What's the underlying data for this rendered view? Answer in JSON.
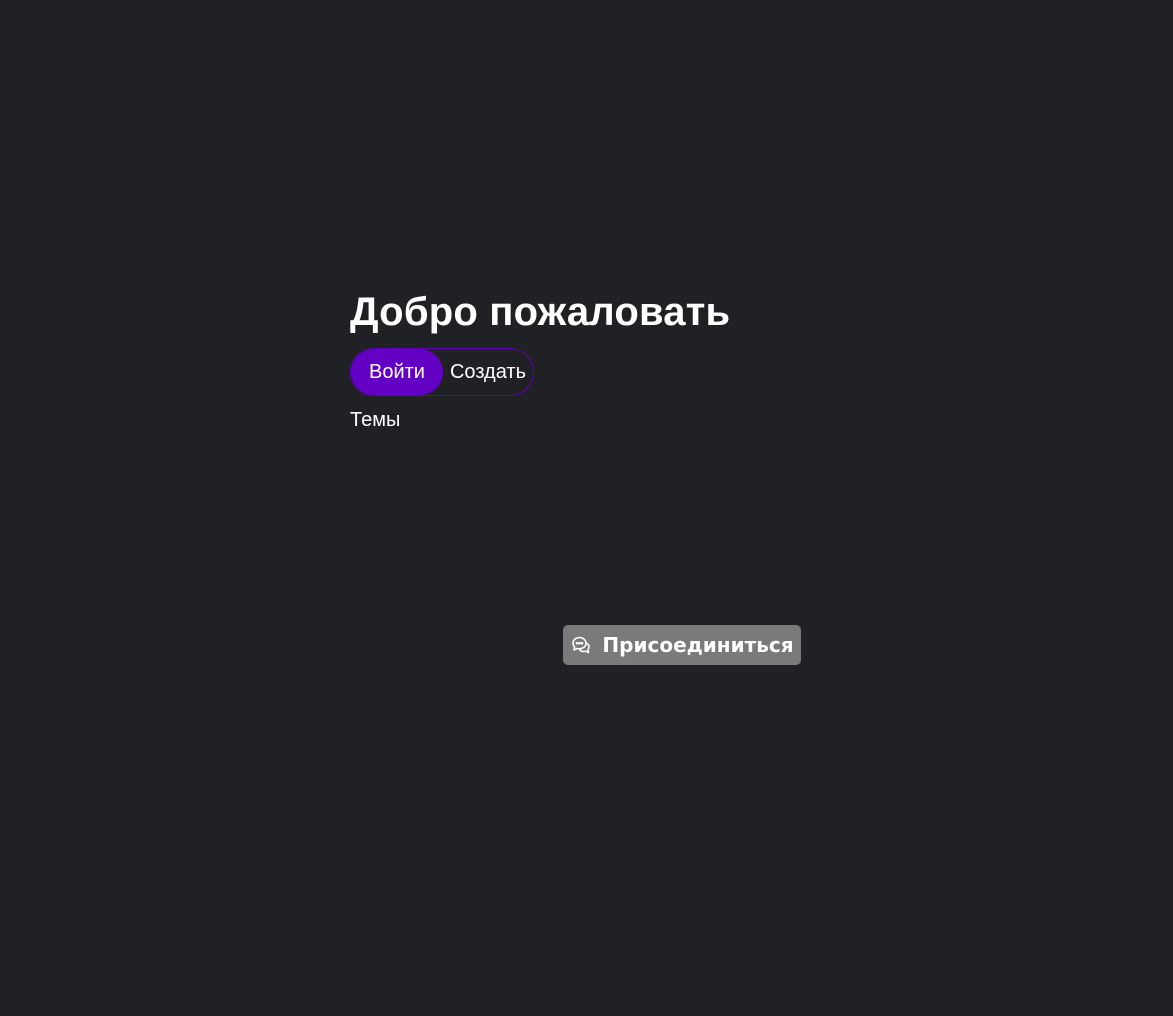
{
  "welcome": {
    "title": "Добро пожаловать",
    "tabs": {
      "login": "Войти",
      "create": "Создать"
    },
    "themes_label": "Темы"
  },
  "join": {
    "label": "Присоединиться",
    "icon": "chat-bubbles-icon",
    "background": "#7a7a7a"
  },
  "colors": {
    "background": "#202125",
    "accent": "#6200c4"
  }
}
